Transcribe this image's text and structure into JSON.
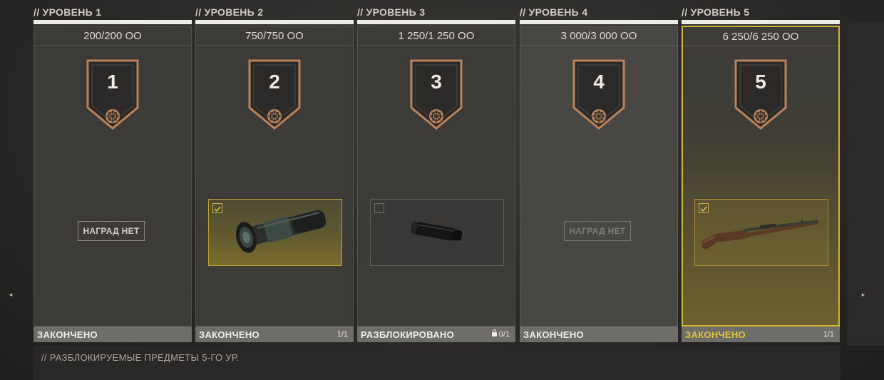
{
  "nav": {
    "left_arrow": "◂",
    "right_arrow": "▸"
  },
  "levels": [
    {
      "header": "// УРОВЕНЬ 1",
      "xp": "200/200 ОО",
      "number": "1",
      "reward": null,
      "no_reward_label": "НАГРАД НЕТ",
      "status": "ЗАКОНЧЕНО",
      "count": ""
    },
    {
      "header": "// УРОВЕНЬ 2",
      "xp": "750/750 ОО",
      "number": "2",
      "reward": "scope",
      "status": "ЗАКОНЧЕНО",
      "count": "1/1"
    },
    {
      "header": "// УРОВЕНЬ 3",
      "xp": "1 250/1 250 ОО",
      "number": "3",
      "reward": "suppressor",
      "status": "РАЗБЛОКИРОВАНО",
      "count": "0/1"
    },
    {
      "header": "// УРОВЕНЬ 4",
      "xp": "3 000/3 000 ОО",
      "number": "4",
      "reward": null,
      "no_reward_label": "НАГРАД НЕТ",
      "status": "ЗАКОНЧЕНО",
      "count": ""
    },
    {
      "header": "// УРОВЕНЬ 5",
      "xp": "6 250/6 250 ОО",
      "number": "5",
      "reward": "rifle",
      "status": "ЗАКОНЧЕНО",
      "count": "1/1"
    }
  ],
  "footer": {
    "text": "// РАЗБЛОКИРУЕМЫЕ ПРЕДМЕТЫ 5-ГО УР."
  },
  "colors": {
    "accent_gold": "#cfb23a",
    "badge_bronze": "#b9825a",
    "status_gold": "#e5c33c"
  }
}
